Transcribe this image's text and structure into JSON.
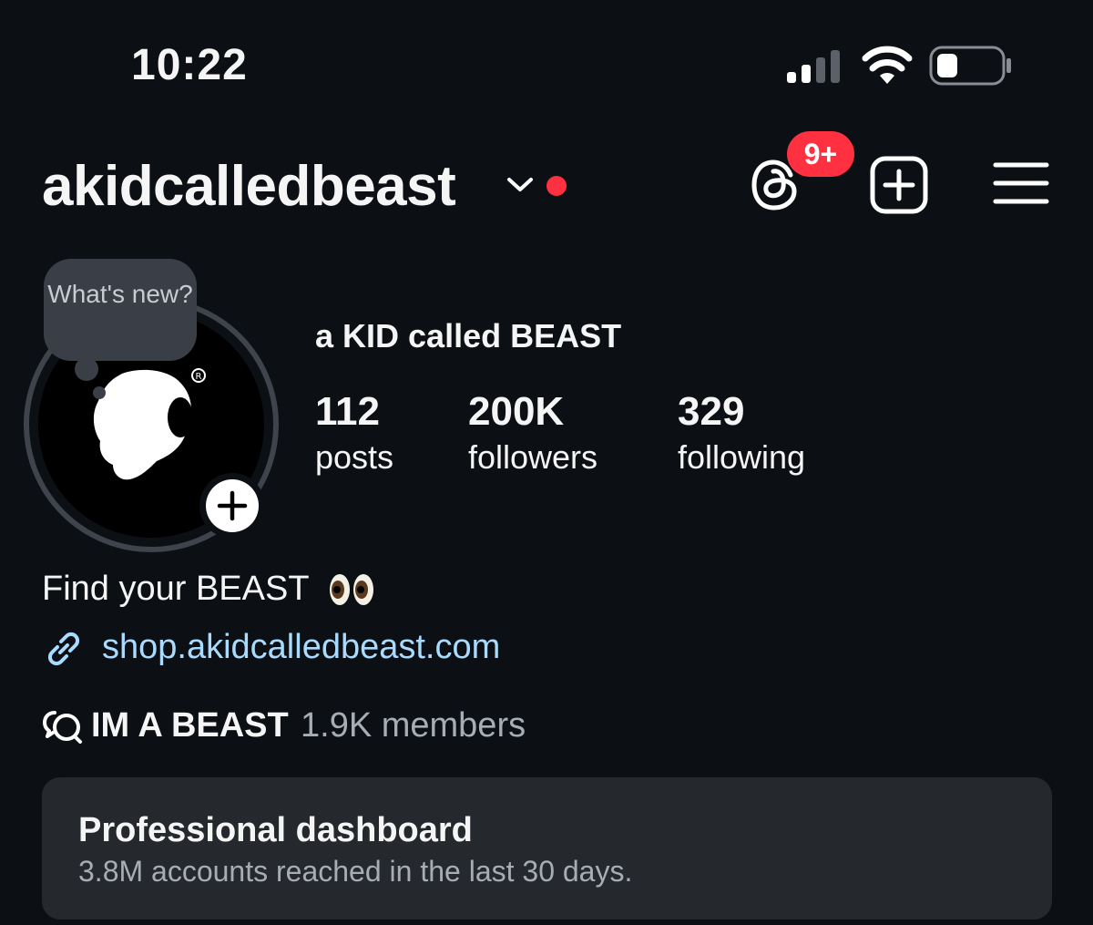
{
  "status_bar": {
    "time": "10:22"
  },
  "header": {
    "username": "akidcalledbeast",
    "notification_badge": "9+",
    "icons": [
      "chevron-down-icon",
      "threads-icon",
      "create-plus-icon",
      "menu-icon"
    ],
    "accent_red": "#ff3040"
  },
  "note": {
    "text": "What's new?"
  },
  "profile": {
    "display_name": "a KID called BEAST",
    "stats": [
      {
        "value": "112",
        "label": "posts"
      },
      {
        "value": "200K",
        "label": "followers"
      },
      {
        "value": "329",
        "label": "following"
      }
    ],
    "bio": "Find your BEAST",
    "link": "shop.akidcalledbeast.com",
    "link_color": "#a9dbff",
    "channel": {
      "name": "IM A BEAST",
      "members": "1.9K members"
    }
  },
  "dashboard": {
    "title": "Professional dashboard",
    "subtitle": "3.8M accounts reached in the last 30 days."
  }
}
